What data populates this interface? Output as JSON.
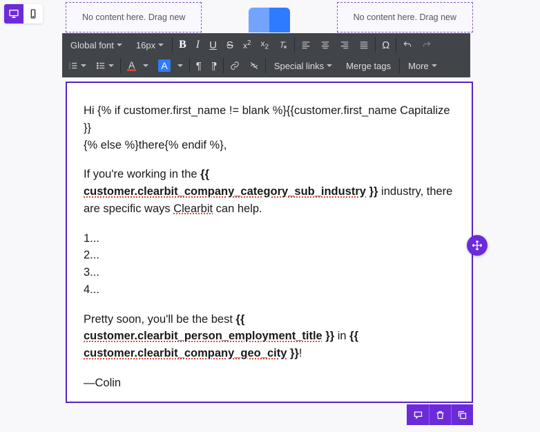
{
  "device_switcher": {
    "desktop_active": true
  },
  "dropzones": {
    "left": "No content here. Drag new",
    "right": "No content here. Drag new"
  },
  "toolbar": {
    "font_family": "Global font",
    "font_size": "16px",
    "special_links": "Special links",
    "merge_tags": "Merge tags",
    "more": "More"
  },
  "email": {
    "p1_a": "Hi {% if customer.first_name != blank %}{{customer.first_name Capitalize }}",
    "p1_b": "{% else %}there{% endif %},",
    "p2_a": "If you're working in the ",
    "p2_merge_open": "{{",
    "p2_merge": "customer.clearbit_company_category_sub_industry",
    "p2_merge_close": " }}",
    "p2_b": " industry, there are specific ways ",
    "p2_clearbit": "Clearbit",
    "p2_c": " can help.",
    "l1": "1...",
    "l2": "2...",
    "l3": "3...",
    "l4": "4...",
    "p3_a": "Pretty soon, you'll be the best ",
    "p3_m1_open": "{{",
    "p3_m1": "customer.clearbit_person_employment_title",
    "p3_m1_close": " }}",
    "p3_in": " in ",
    "p3_m2_open": "{{",
    "p3_m2": "customer.clearbit_company_geo_city",
    "p3_m2_close": " }}",
    "p3_end": "!",
    "sign": "—Colin"
  }
}
